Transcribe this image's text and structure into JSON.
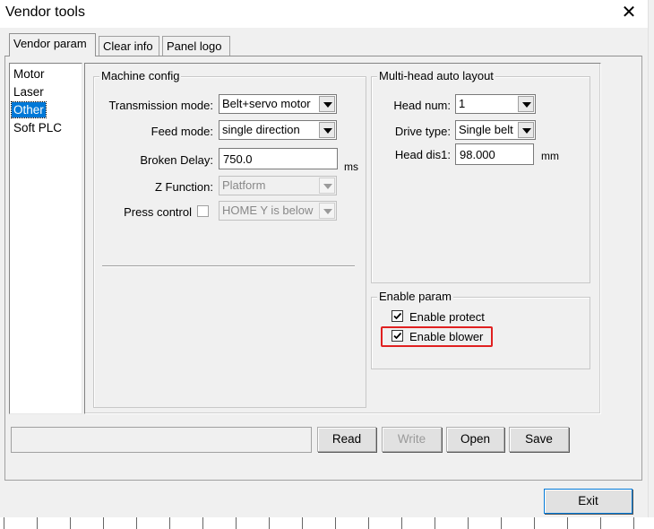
{
  "window": {
    "title": "Vendor tools",
    "close_glyph": "✕"
  },
  "tabs": [
    {
      "label": "Vendor param",
      "active": true
    },
    {
      "label": "Clear info",
      "active": false
    },
    {
      "label": "Panel logo",
      "active": false
    }
  ],
  "categories": [
    {
      "label": "Motor",
      "selected": false
    },
    {
      "label": "Laser",
      "selected": false
    },
    {
      "label": "Other",
      "selected": true
    },
    {
      "label": "Soft PLC",
      "selected": false
    }
  ],
  "machine_config": {
    "title": "Machine config",
    "transmission_mode": {
      "label": "Transmission mode:",
      "value": "Belt+servo motor"
    },
    "feed_mode": {
      "label": "Feed mode:",
      "value": "single direction"
    },
    "broken_delay": {
      "label": "Broken Delay:",
      "value": "750.0",
      "unit": "ms"
    },
    "z_function": {
      "label": "Z Function:",
      "value": "Platform"
    },
    "press_control": {
      "label": "Press control",
      "checked": false,
      "value": "HOME Y is below"
    }
  },
  "multi_head": {
    "title": "Multi-head auto layout",
    "head_num": {
      "label": "Head num:",
      "value": "1"
    },
    "drive_type": {
      "label": "Drive type:",
      "value": "Single belt"
    },
    "head_dis": {
      "label": "Head dis1:",
      "value": "98.000",
      "unit": "mm"
    }
  },
  "enable_param": {
    "title": "Enable param",
    "enable_protect": {
      "label": "Enable protect",
      "checked": true
    },
    "enable_blower": {
      "label": "Enable blower",
      "checked": true
    }
  },
  "buttons": {
    "read": "Read",
    "write": "Write",
    "open": "Open",
    "save": "Save",
    "exit": "Exit"
  },
  "colors": {
    "highlight": "#e02020",
    "selection": "#0078d7",
    "window_bg": "#f0f0f0"
  }
}
